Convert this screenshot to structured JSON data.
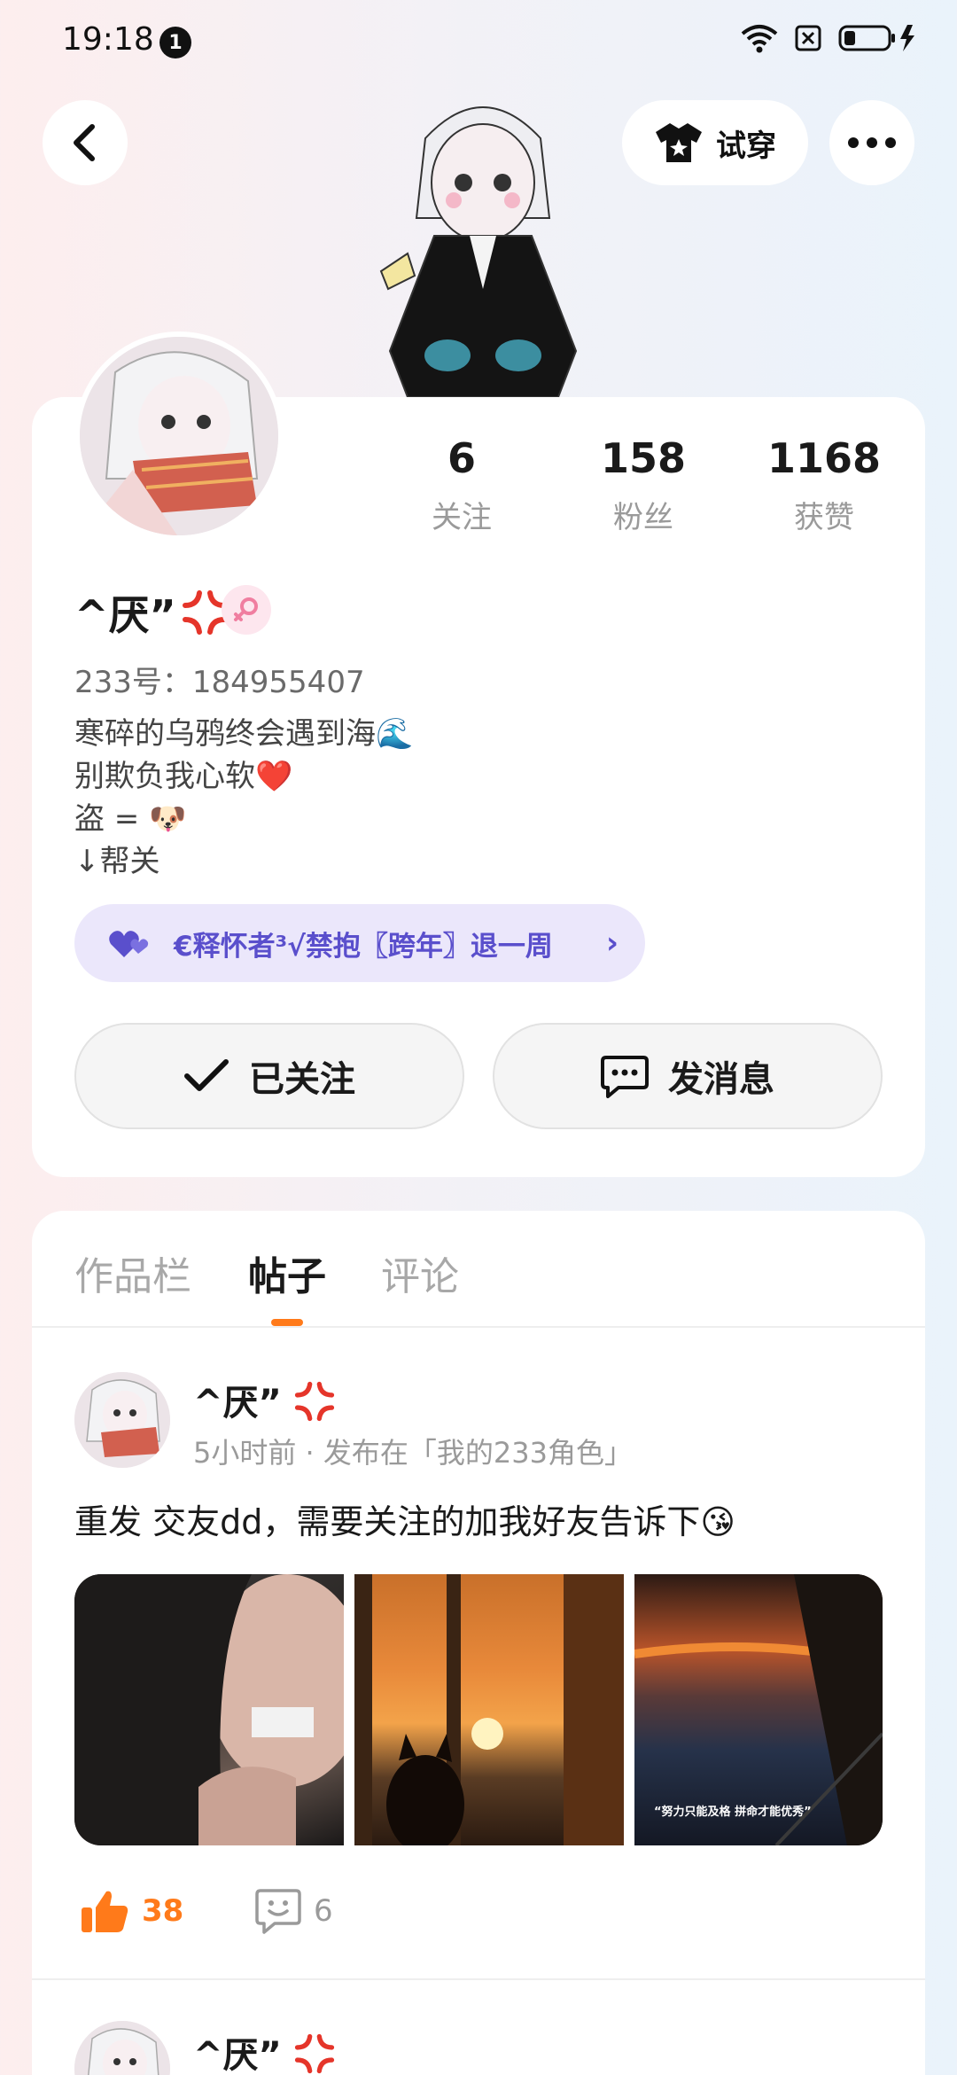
{
  "status_bar": {
    "time": "19:18",
    "notification_count": "1"
  },
  "header": {
    "try_on_label": "试穿"
  },
  "profile": {
    "username": "^厌”",
    "user_id": "233号：184955407",
    "stats": [
      {
        "value": "6",
        "label": "关注"
      },
      {
        "value": "158",
        "label": "粉丝"
      },
      {
        "value": "1168",
        "label": "获赞"
      }
    ],
    "bio_lines": [
      "寒碎的乌鸦终会遇到海🌊",
      "别欺负我心软❤️",
      "盗 = 🐶",
      "↓帮关"
    ],
    "guard_badge": "€释怀者³√禁抱〖跨年〗退一周",
    "follow_button": "已关注",
    "message_button": "发消息"
  },
  "tabs": [
    {
      "label": "作品栏",
      "active": false
    },
    {
      "label": "帖子",
      "active": true
    },
    {
      "label": "评论",
      "active": false
    }
  ],
  "posts": [
    {
      "author": "^厌”",
      "meta": "5小时前 · 发布在「我的233角色」",
      "text": "重发 交友dd，需要关注的加我好友告诉下😘",
      "photo_caption": "“努力只能及格 拼命才能优秀”",
      "likes": "38",
      "comments": "6"
    },
    {
      "author": "^厌”"
    }
  ],
  "colors": {
    "accent": "#ff7a1a",
    "guard_text": "#5a4fcc",
    "guard_bg": "#ebe7fb"
  }
}
